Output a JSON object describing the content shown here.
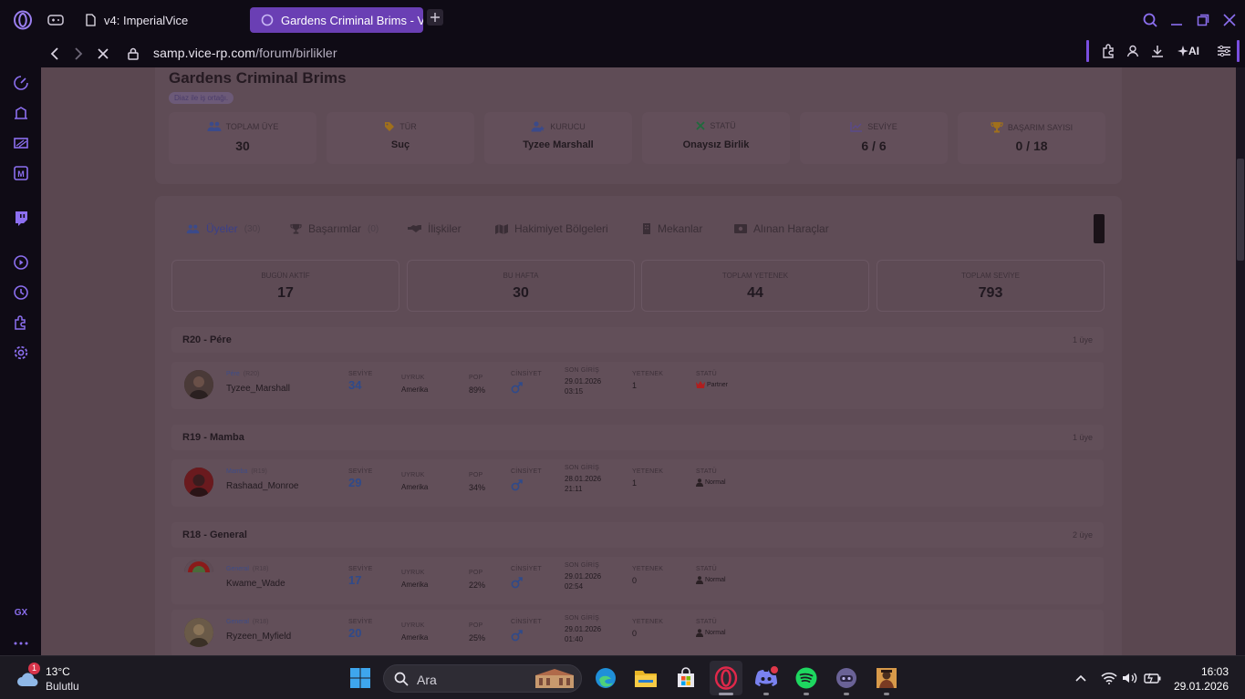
{
  "browser": {
    "tabs": [
      {
        "title": "v4: ImperialVice"
      },
      {
        "title": "Gardens Criminal Brims - V"
      }
    ],
    "url_host": "samp.vice-rp.com",
    "url_path": "/forum/birlikler",
    "ai_label": "AI",
    "sidebar_badge": "GX"
  },
  "faction": {
    "name": "Gardens Criminal Brims",
    "tagline": "Diaz ile iş ortağı.",
    "stats": [
      {
        "label": "TOPLAM ÜYE",
        "value": "30",
        "icon": "users-icon"
      },
      {
        "label": "TÜR",
        "value": "Suç",
        "icon": "tag-icon"
      },
      {
        "label": "KURUCU",
        "value": "Tyzee Marshall",
        "icon": "founder-icon"
      },
      {
        "label": "STATÜ",
        "value": "Onaysız Birlik",
        "icon": "x-icon"
      },
      {
        "label": "SEVİYE",
        "value": "6 / 6",
        "icon": "chart-icon"
      },
      {
        "label": "BAŞARIM SAYISI",
        "value": "0 / 18",
        "icon": "trophy-icon"
      }
    ]
  },
  "tabs": [
    {
      "label": "Üyeler",
      "count": "(30)"
    },
    {
      "label": "Başarımlar",
      "count": "(0)"
    },
    {
      "label": "İlişkiler",
      "count": ""
    },
    {
      "label": "Hakimiyet Bölgeleri",
      "count": ""
    },
    {
      "label": "Mekanlar",
      "count": ""
    },
    {
      "label": "Alınan Haraçlar",
      "count": ""
    }
  ],
  "summary": [
    {
      "label": "BUGÜN AKTİF",
      "value": "17"
    },
    {
      "label": "BU HAFTA",
      "value": "30"
    },
    {
      "label": "TOPLAM YETENEK",
      "value": "44"
    },
    {
      "label": "TOPLAM SEVİYE",
      "value": "793"
    }
  ],
  "columns": {
    "level": "SEVİYE",
    "nation": "UYRUK",
    "pop": "POP",
    "gender": "CİNSİYET",
    "last_login": "SON GİRİŞ",
    "skill": "YETENEK",
    "status": "STATÜ"
  },
  "groups": [
    {
      "name": "R20 - Pére",
      "count": "1 üye"
    },
    {
      "name": "R19 - Mamba",
      "count": "1 üye"
    },
    {
      "name": "R18 - General",
      "count": "2 üye"
    }
  ],
  "members": [
    {
      "rank": "Pére",
      "rank_code": "(R20)",
      "name": "Tyzee_Marshall",
      "level": "34",
      "nation": "Amerika",
      "pop": "89%",
      "login_date": "29.01.2026",
      "login_time": "03:15",
      "skill": "1",
      "status": "Partner"
    },
    {
      "rank": "Mamba",
      "rank_code": "(R19)",
      "name": "Rashaad_Monroe",
      "level": "29",
      "nation": "Amerika",
      "pop": "34%",
      "login_date": "28.01.2026",
      "login_time": "21:11",
      "skill": "1",
      "status": "Normal"
    },
    {
      "rank": "General",
      "rank_code": "(R18)",
      "name": "Kwame_Wade",
      "level": "17",
      "nation": "Amerika",
      "pop": "22%",
      "login_date": "29.01.2026",
      "login_time": "02:54",
      "skill": "0",
      "status": "Normal"
    },
    {
      "rank": "General",
      "rank_code": "(R18)",
      "name": "Ryzeen_Myfield",
      "level": "20",
      "nation": "Amerika",
      "pop": "25%",
      "login_date": "29.01.2026",
      "login_time": "01:40",
      "skill": "0",
      "status": "Normal"
    }
  ],
  "taskbar": {
    "temp": "13°C",
    "weather": "Bulutlu",
    "weather_badge": "1",
    "search_placeholder": "Ara",
    "time": "16:03",
    "date": "29.01.2026"
  }
}
